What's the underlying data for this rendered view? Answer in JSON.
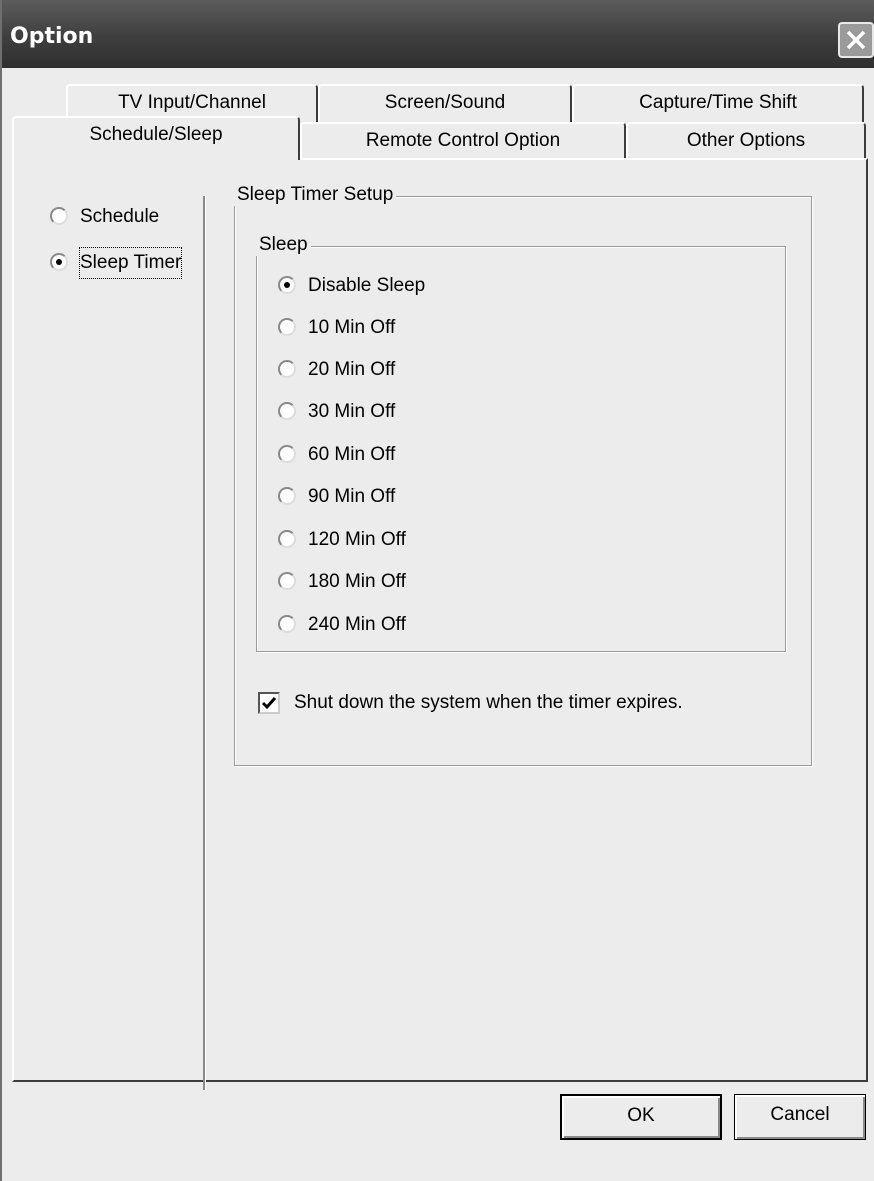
{
  "window": {
    "title": "Option"
  },
  "tabs": {
    "row1": [
      "TV Input/Channel",
      "Screen/Sound",
      "Capture/Time Shift"
    ],
    "row2": [
      "Schedule/Sleep",
      "Remote Control Option",
      "Other Options"
    ],
    "active": "Schedule/Sleep"
  },
  "sidebar": {
    "items": [
      {
        "label": "Schedule",
        "selected": false
      },
      {
        "label": "Sleep Timer",
        "selected": true
      }
    ]
  },
  "sleep_timer_setup": {
    "group_title": "Sleep Timer Setup",
    "sleep_group_title": "Sleep",
    "options": [
      {
        "label": "Disable Sleep",
        "selected": true
      },
      {
        "label": "10 Min Off",
        "selected": false
      },
      {
        "label": "20 Min Off",
        "selected": false
      },
      {
        "label": "30 Min Off",
        "selected": false
      },
      {
        "label": "60 Min Off",
        "selected": false
      },
      {
        "label": "90 Min Off",
        "selected": false
      },
      {
        "label": "120 Min Off",
        "selected": false
      },
      {
        "label": "180 Min Off",
        "selected": false
      },
      {
        "label": "240 Min Off",
        "selected": false
      }
    ],
    "shutdown_label": "Shut down the system when the timer expires.",
    "shutdown_checked": true
  },
  "buttons": {
    "ok_label": "OK",
    "cancel_label": "Cancel"
  },
  "colors": {
    "titlebar": "#3e3e3e",
    "window_bg": "#ececec"
  }
}
